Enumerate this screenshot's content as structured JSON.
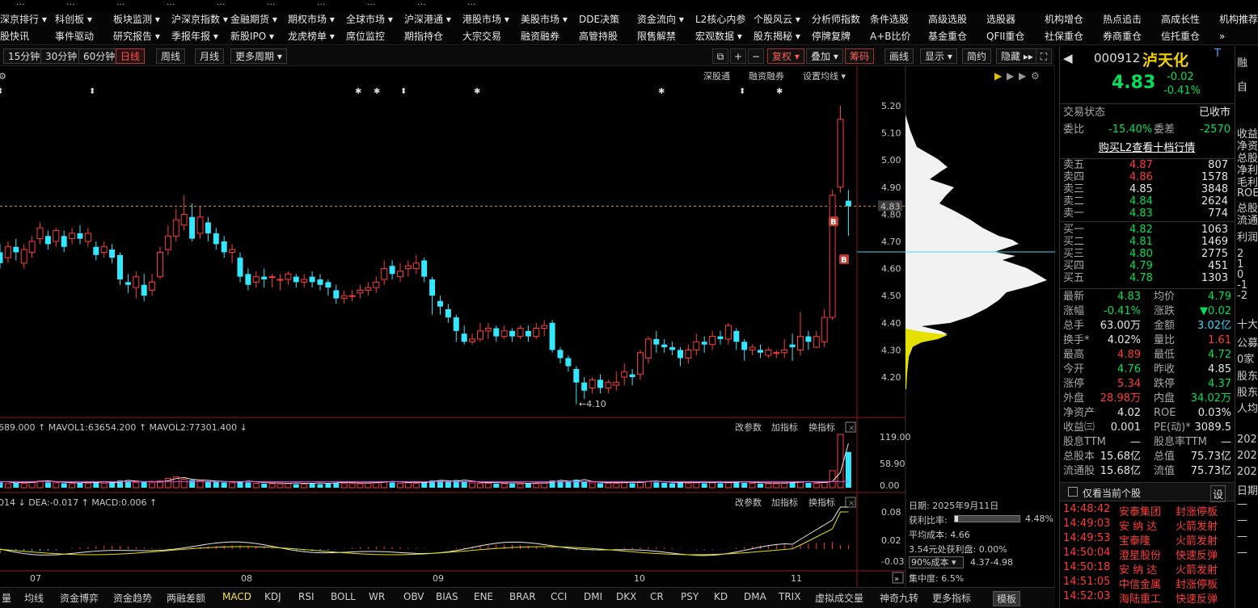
{
  "top_strip": [
    "...",
    "...",
    "...",
    "...",
    "...",
    "...",
    "...",
    "...",
    "...",
    "..."
  ],
  "menu_row1": [
    "深京排行 ▾",
    "科创板 ▾",
    "板块监测 ▾",
    "沪深京指数 ▾",
    "金融期货 ▾",
    "期权市场 ▾",
    "全球市场 ▾",
    "沪深港通 ▾",
    "港股市场 ▾",
    "美股市场 ▾",
    "DDE决策",
    "资金流向 ▾",
    "L2核心内参",
    "个股风云 ▾",
    "分析师指数",
    "条件选股",
    "高级选股",
    "选股器",
    "机构增仓",
    "热点追击",
    "高成长性",
    "机构推荐"
  ],
  "menu_row2": [
    "股快讯",
    "事件驱动",
    "研究报告 ▾",
    "季报年报 ▾",
    "新股IPO ▾",
    "龙虎榜单 ▾",
    "席位监控",
    "期指持仓",
    "大宗交易",
    "融资融券",
    "高管持股",
    "限售解禁",
    "宏观数据 ▾",
    "股东揭秘 ▾",
    "停牌复牌",
    "A+B比价",
    "基金重仓",
    "QFII重仓",
    "社保重仓",
    "券商重仓",
    "信托重仓",
    "»"
  ],
  "toolbar": {
    "periods": [
      "15分钟",
      "30分钟",
      "60分钟",
      "日线",
      "周线",
      "月线",
      "更多周期 ▾"
    ],
    "active_period": "日线",
    "right_buttons": [
      "复权 ▾",
      "叠加 ▾",
      "筹码",
      "画线",
      "显示 ▾",
      "简约",
      "隐藏 ▸▸"
    ]
  },
  "chart_top_links": [
    "深股通",
    "融资融券",
    "设置均线 ▾"
  ],
  "price_panel": {
    "y_ticks": [
      "5.20",
      "5.10",
      "5.00",
      "4.90",
      "4.80",
      "4.70",
      "4.60",
      "4.50",
      "4.40",
      "4.30",
      "4.20"
    ],
    "current_price_tag": "4.83",
    "low_label": "←4.10",
    "markers": [
      "B",
      "B"
    ]
  },
  "volume_panel": {
    "header": "689.000 ↑ MAVOL1:63654.200 ↑ MAVOL2:77301.400 ↓",
    "buttons": [
      "改参数",
      "加指标",
      "换指标"
    ],
    "y_ticks": [
      "119.00",
      "58.90",
      "0.00"
    ]
  },
  "macd_panel": {
    "header": "014 ↓ DEA:-0.017 ↑ MACD:0.006 ↑",
    "buttons": [
      "改参数",
      "加指标",
      "换指标"
    ],
    "y_ticks": [
      "0.08",
      "0.02",
      "-0.03"
    ]
  },
  "x_labels": [
    "07",
    "08",
    "09",
    "10",
    "11"
  ],
  "cost_box": {
    "date": "日期: 2025年9月11日",
    "profit_ratio_label": "获利比率:",
    "profit_ratio": "4.48%",
    "avg_cost": "平均成本: 4.66",
    "profit_at": "3.54元处获利盘: 0.00%",
    "cost_select": "90%成本 ▾",
    "cost_range": "4.37-4.98",
    "concentration": "集中度: 6.5%"
  },
  "bottom_tabs": [
    "量",
    "均线",
    "资金博弈",
    "资金趋势",
    "两融差额",
    "MACD",
    "KDJ",
    "RSI",
    "BOLL",
    "WR",
    "OBV",
    "BIAS",
    "ENE",
    "BRAR",
    "CCI",
    "DMI",
    "DKX",
    "CR",
    "PSY",
    "KD",
    "DMA",
    "TRIX",
    "虚拟成交量",
    "神奇九转",
    "更多指标",
    "模板"
  ],
  "active_bottom_tab": "MACD",
  "quote": {
    "code": "000912",
    "name": "泸天化",
    "tag": "T",
    "price": "4.83",
    "change": "-0.02",
    "change_pct": "-0.41%",
    "status_label": "交易状态",
    "status_value": "已收市",
    "weibi_label": "委比",
    "weibi": "-15.40%",
    "weicha_label": "委差",
    "weicha": "-2570",
    "l2_link": "购买L2查看十档行情",
    "asks": [
      {
        "label": "卖五",
        "price": "4.87",
        "vol": "807",
        "color": "red"
      },
      {
        "label": "卖四",
        "price": "4.86",
        "vol": "1578",
        "color": "red"
      },
      {
        "label": "卖三",
        "price": "4.85",
        "vol": "3848",
        "color": "wht"
      },
      {
        "label": "卖二",
        "price": "4.84",
        "vol": "2624",
        "color": "grn"
      },
      {
        "label": "卖一",
        "price": "4.83",
        "vol": "774",
        "color": "grn"
      }
    ],
    "bids": [
      {
        "label": "买一",
        "price": "4.82",
        "vol": "1063",
        "color": "grn"
      },
      {
        "label": "买二",
        "price": "4.81",
        "vol": "1469",
        "color": "grn"
      },
      {
        "label": "买三",
        "price": "4.80",
        "vol": "2775",
        "color": "grn"
      },
      {
        "label": "买四",
        "price": "4.79",
        "vol": "451",
        "color": "grn"
      },
      {
        "label": "买五",
        "price": "4.78",
        "vol": "1303",
        "color": "grn"
      }
    ],
    "stats": [
      {
        "l1": "最新",
        "v1": "4.83",
        "c1": "grn",
        "l2": "均价",
        "v2": "4.79",
        "c2": "grn"
      },
      {
        "l1": "涨幅",
        "v1": "-0.41%",
        "c1": "grn",
        "l2": "涨跌",
        "v2": "▼0.02",
        "c2": "grn"
      },
      {
        "l1": "总手",
        "v1": "63.00万",
        "c1": "wht",
        "l2": "金额",
        "v2": "3.02亿",
        "c2": "cyan"
      },
      {
        "l1": "换手*",
        "v1": "4.02%",
        "c1": "wht",
        "l2": "量比",
        "v2": "1.61",
        "c2": "red"
      },
      {
        "l1": "最高",
        "v1": "4.89",
        "c1": "red",
        "l2": "最低",
        "v2": "4.72",
        "c2": "grn"
      },
      {
        "l1": "今开",
        "v1": "4.76",
        "c1": "grn",
        "l2": "昨收",
        "v2": "4.85",
        "c2": "wht"
      },
      {
        "l1": "涨停",
        "v1": "5.34",
        "c1": "red",
        "l2": "跌停",
        "v2": "4.37",
        "c2": "grn"
      },
      {
        "l1": "外盘",
        "v1": "28.98万",
        "c1": "red",
        "l2": "内盘",
        "v2": "34.02万",
        "c2": "grn"
      },
      {
        "l1": "净资产",
        "v1": "4.02",
        "c1": "wht",
        "l2": "ROE",
        "v2": "0.03%",
        "c2": "wht"
      },
      {
        "l1": "收益㈢",
        "v1": "0.001",
        "c1": "wht",
        "l2": "PE(动)*",
        "v2": "3089.5",
        "c2": "wht"
      },
      {
        "l1": "股息TTM",
        "v1": "—",
        "c1": "wht",
        "l2": "股息率TTM",
        "v2": "—",
        "c2": "wht"
      },
      {
        "l1": "总股本",
        "v1": "15.68亿",
        "c1": "wht",
        "l2": "总值",
        "v2": "75.73亿",
        "c2": "wht"
      },
      {
        "l1": "流通股",
        "v1": "15.68亿",
        "c1": "wht",
        "l2": "流值",
        "v2": "75.73亿",
        "c2": "wht"
      }
    ],
    "only_current_label": "仅看当前个股",
    "ticker": [
      {
        "time": "14:48:42",
        "name": "安泰集团",
        "event": "封涨停板"
      },
      {
        "time": "14:49:03",
        "name": "安 纳 达",
        "event": "火箭发射"
      },
      {
        "time": "14:49:53",
        "name": "宝泰隆",
        "event": "火箭发射"
      },
      {
        "time": "14:50:04",
        "name": "澄星股份",
        "event": "快速反弹"
      },
      {
        "time": "14:50:18",
        "name": "安 纳 达",
        "event": "火箭发射"
      },
      {
        "time": "14:51:05",
        "name": "中信金属",
        "event": "封涨停板"
      },
      {
        "time": "14:52:03",
        "name": "海陆重工",
        "event": "快速反弹"
      }
    ]
  },
  "far_panel": [
    "融",
    "自",
    "",
    "收益",
    "净资",
    "总股",
    "净利",
    "毛利",
    "ROE",
    "总股",
    "流通",
    "利润",
    "2",
    "1",
    "0",
    "-1",
    "-2",
    "十大",
    "公募",
    "0家",
    "股东",
    "股东",
    "人均",
    "202",
    "202",
    "202",
    "日期",
    "—",
    "—",
    "—",
    "—"
  ],
  "chart_data": {
    "type": "candlestick",
    "price_range": [
      4.1,
      5.25
    ],
    "candles": [
      [
        4.66,
        4.62,
        4.69,
        4.6
      ],
      [
        4.64,
        4.68,
        4.7,
        4.62
      ],
      [
        4.68,
        4.66,
        4.71,
        4.63
      ],
      [
        4.62,
        4.67,
        4.69,
        4.6
      ],
      [
        4.66,
        4.7,
        4.72,
        4.64
      ],
      [
        4.71,
        4.75,
        4.77,
        4.69
      ],
      [
        4.72,
        4.69,
        4.74,
        4.67
      ],
      [
        4.7,
        4.74,
        4.75,
        4.68
      ],
      [
        4.72,
        4.68,
        4.74,
        4.66
      ],
      [
        4.71,
        4.73,
        4.75,
        4.69
      ],
      [
        4.73,
        4.71,
        4.76,
        4.69
      ],
      [
        4.7,
        4.73,
        4.75,
        4.68
      ],
      [
        4.68,
        4.65,
        4.7,
        4.63
      ],
      [
        4.66,
        4.68,
        4.7,
        4.64
      ],
      [
        4.67,
        4.64,
        4.69,
        4.62
      ],
      [
        4.65,
        4.56,
        4.66,
        4.54
      ],
      [
        4.55,
        4.54,
        4.58,
        4.51
      ],
      [
        4.53,
        4.57,
        4.59,
        4.49
      ],
      [
        4.54,
        4.5,
        4.58,
        4.48
      ],
      [
        4.52,
        4.55,
        4.58,
        4.5
      ],
      [
        4.57,
        4.66,
        4.68,
        4.56
      ],
      [
        4.67,
        4.72,
        4.76,
        4.65
      ],
      [
        4.72,
        4.78,
        4.82,
        4.7
      ],
      [
        4.76,
        4.8,
        4.87,
        4.74
      ],
      [
        4.79,
        4.71,
        4.84,
        4.7
      ],
      [
        4.73,
        4.79,
        4.83,
        4.71
      ],
      [
        4.77,
        4.73,
        4.79,
        4.7
      ],
      [
        4.73,
        4.69,
        4.75,
        4.67
      ],
      [
        4.7,
        4.66,
        4.72,
        4.64
      ],
      [
        4.66,
        4.67,
        4.69,
        4.62
      ],
      [
        4.64,
        4.57,
        4.66,
        4.55
      ],
      [
        4.58,
        4.54,
        4.6,
        4.52
      ],
      [
        4.55,
        4.57,
        4.59,
        4.53
      ],
      [
        4.57,
        4.56,
        4.6,
        4.53
      ],
      [
        4.57,
        4.57,
        4.58,
        4.53
      ],
      [
        4.56,
        4.56,
        4.58,
        4.52
      ],
      [
        4.56,
        4.58,
        4.59,
        4.54
      ],
      [
        4.57,
        4.55,
        4.58,
        4.53
      ],
      [
        4.55,
        4.56,
        4.58,
        4.53
      ],
      [
        4.57,
        4.55,
        4.59,
        4.53
      ],
      [
        4.56,
        4.54,
        4.58,
        4.52
      ],
      [
        4.55,
        4.53,
        4.56,
        4.5
      ],
      [
        4.52,
        4.49,
        4.54,
        4.47
      ],
      [
        4.49,
        4.5,
        4.52,
        4.47
      ],
      [
        4.5,
        4.5,
        4.52,
        4.48
      ],
      [
        4.51,
        4.52,
        4.54,
        4.49
      ],
      [
        4.52,
        4.53,
        4.55,
        4.5
      ],
      [
        4.53,
        4.55,
        4.57,
        4.51
      ],
      [
        4.56,
        4.6,
        4.63,
        4.54
      ],
      [
        4.61,
        4.58,
        4.63,
        4.56
      ],
      [
        4.57,
        4.59,
        4.62,
        4.55
      ],
      [
        4.6,
        4.61,
        4.63,
        4.57
      ],
      [
        4.6,
        4.62,
        4.65,
        4.58
      ],
      [
        4.63,
        4.57,
        4.64,
        4.55
      ],
      [
        4.56,
        4.5,
        4.57,
        4.43
      ],
      [
        4.48,
        4.46,
        4.5,
        4.43
      ],
      [
        4.45,
        4.42,
        4.47,
        4.4
      ],
      [
        4.42,
        4.37,
        4.43,
        4.33
      ],
      [
        4.36,
        4.33,
        4.39,
        4.32
      ],
      [
        4.33,
        4.34,
        4.36,
        4.32
      ],
      [
        4.34,
        4.37,
        4.4,
        4.33
      ],
      [
        4.37,
        4.38,
        4.4,
        4.34
      ],
      [
        4.38,
        4.35,
        4.39,
        4.33
      ],
      [
        4.35,
        4.37,
        4.39,
        4.34
      ],
      [
        4.37,
        4.35,
        4.38,
        4.33
      ],
      [
        4.35,
        4.38,
        4.39,
        4.34
      ],
      [
        4.37,
        4.35,
        4.39,
        4.33
      ],
      [
        4.35,
        4.38,
        4.4,
        4.34
      ],
      [
        4.38,
        4.39,
        4.41,
        4.35
      ],
      [
        4.4,
        4.3,
        4.41,
        4.29
      ],
      [
        4.3,
        4.27,
        4.31,
        4.25
      ],
      [
        4.27,
        4.24,
        4.28,
        4.22
      ],
      [
        4.23,
        4.18,
        4.24,
        4.1
      ],
      [
        4.18,
        4.15,
        4.2,
        4.12
      ],
      [
        4.16,
        4.19,
        4.2,
        4.14
      ],
      [
        4.19,
        4.16,
        4.21,
        4.14
      ],
      [
        4.16,
        4.18,
        4.19,
        4.14
      ],
      [
        4.17,
        4.18,
        4.22,
        4.15
      ],
      [
        4.2,
        4.22,
        4.25,
        4.17
      ],
      [
        4.21,
        4.2,
        4.23,
        4.17
      ],
      [
        4.21,
        4.29,
        4.3,
        4.19
      ],
      [
        4.27,
        4.34,
        4.35,
        4.25
      ],
      [
        4.34,
        4.32,
        4.37,
        4.29
      ],
      [
        4.32,
        4.31,
        4.34,
        4.29
      ],
      [
        4.31,
        4.3,
        4.33,
        4.28
      ],
      [
        4.3,
        4.27,
        4.31,
        4.24
      ],
      [
        4.27,
        4.3,
        4.32,
        4.25
      ],
      [
        4.3,
        4.33,
        4.36,
        4.28
      ],
      [
        4.33,
        4.32,
        4.35,
        4.29
      ],
      [
        4.32,
        4.35,
        4.37,
        4.3
      ],
      [
        4.35,
        4.34,
        4.37,
        4.32
      ],
      [
        4.34,
        4.39,
        4.4,
        4.32
      ],
      [
        4.37,
        4.33,
        4.38,
        4.3
      ],
      [
        4.33,
        4.3,
        4.34,
        4.26
      ],
      [
        4.3,
        4.31,
        4.32,
        4.28
      ],
      [
        4.3,
        4.29,
        4.32,
        4.27
      ],
      [
        4.28,
        4.3,
        4.31,
        4.27
      ],
      [
        4.29,
        4.29,
        4.3,
        4.27
      ],
      [
        4.29,
        4.3,
        4.34,
        4.27
      ],
      [
        4.32,
        4.31,
        4.36,
        4.26
      ],
      [
        4.3,
        4.35,
        4.44,
        4.28
      ],
      [
        4.35,
        4.33,
        4.37,
        4.3
      ],
      [
        4.31,
        4.35,
        4.37,
        4.31
      ],
      [
        4.33,
        4.42,
        4.45,
        4.31
      ],
      [
        4.42,
        4.87,
        4.89,
        4.41
      ],
      [
        4.9,
        5.15,
        5.2,
        4.88
      ],
      [
        4.85,
        4.83,
        4.89,
        4.72
      ]
    ],
    "volume": [
      12,
      9,
      11,
      10,
      13,
      15,
      12,
      11,
      10,
      9,
      11,
      10,
      12,
      10,
      11,
      16,
      14,
      12,
      13,
      11,
      15,
      21,
      24,
      19,
      17,
      16,
      14,
      13,
      12,
      11,
      14,
      12,
      10,
      9,
      9,
      8,
      9,
      8,
      8,
      9,
      8,
      9,
      11,
      10,
      9,
      9,
      10,
      11,
      13,
      12,
      10,
      11,
      10,
      12,
      16,
      15,
      13,
      17,
      14,
      11,
      10,
      10,
      9,
      9,
      9,
      8,
      9,
      9,
      10,
      16,
      14,
      13,
      18,
      13,
      11,
      10,
      10,
      10,
      11,
      10,
      13,
      14,
      12,
      11,
      10,
      11,
      10,
      11,
      10,
      11,
      10,
      11,
      12,
      11,
      10,
      9,
      9,
      9,
      10,
      11,
      13,
      11,
      10,
      13,
      38,
      119,
      80
    ],
    "volume_ticks": [
      0,
      58.9,
      119
    ],
    "macd_dif": [],
    "macd_range": [
      -0.03,
      0.08
    ],
    "x_labels": [
      "07",
      "08",
      "09",
      "10",
      "11"
    ]
  }
}
